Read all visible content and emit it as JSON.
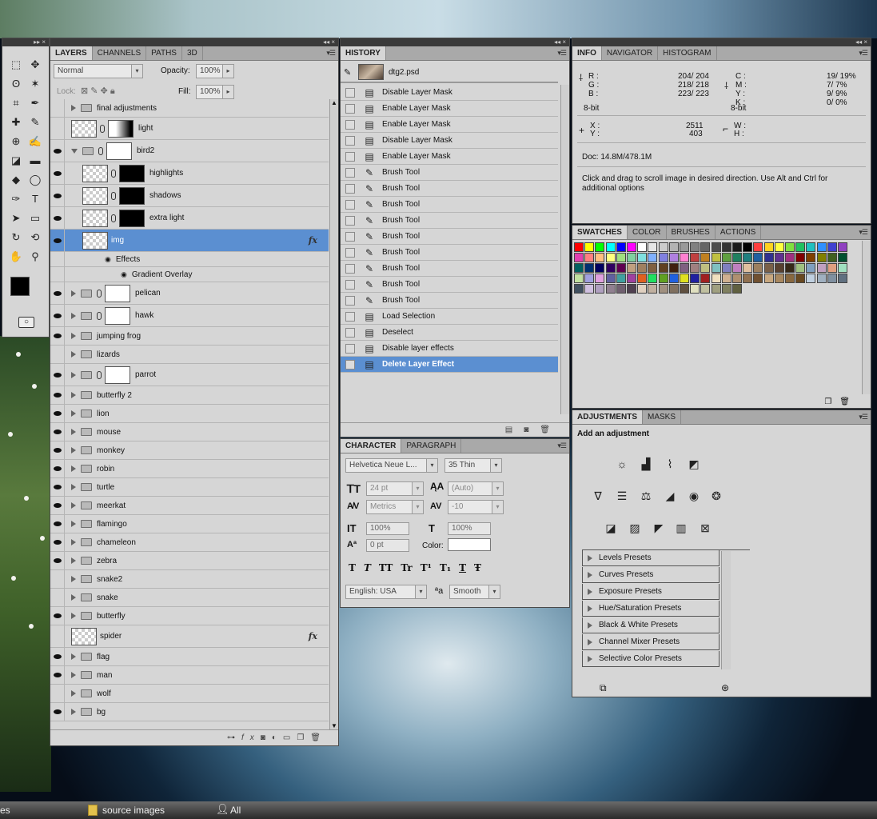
{
  "layers_panel": {
    "tabs": [
      "LAYERS",
      "CHANNELS",
      "PATHS",
      "3D"
    ],
    "blend_mode": "Normal",
    "opacity_label": "Opacity:",
    "opacity": "100%",
    "lock_label": "Lock:",
    "fill_label": "Fill:",
    "fill": "100%",
    "layers": [
      {
        "name": "final adjustments",
        "eye": false,
        "kind": "group"
      },
      {
        "name": "light",
        "eye": false,
        "kind": "layer_mask",
        "mask": "grad"
      },
      {
        "name": "bird2",
        "eye": true,
        "kind": "group_mask",
        "open": true
      },
      {
        "name": "highlights",
        "eye": true,
        "kind": "layer_mask",
        "mask": "blk",
        "indent": true
      },
      {
        "name": "shadows",
        "eye": true,
        "kind": "layer_mask",
        "mask": "blk",
        "indent": true
      },
      {
        "name": "extra light",
        "eye": true,
        "kind": "layer_mask",
        "mask": "blk",
        "indent": true
      },
      {
        "name": "img",
        "eye": true,
        "kind": "layer",
        "selected": true,
        "fx": true,
        "indent": true
      },
      {
        "name": "Effects",
        "eye": false,
        "kind": "effects"
      },
      {
        "name": "Gradient Overlay",
        "eye": false,
        "kind": "effect"
      },
      {
        "name": "pelican",
        "eye": true,
        "kind": "group_mask"
      },
      {
        "name": "hawk",
        "eye": true,
        "kind": "group_mask"
      },
      {
        "name": "jumping frog",
        "eye": true,
        "kind": "group"
      },
      {
        "name": "lizards",
        "eye": false,
        "kind": "group"
      },
      {
        "name": "parrot",
        "eye": true,
        "kind": "group_mask"
      },
      {
        "name": "butterfly 2",
        "eye": true,
        "kind": "group"
      },
      {
        "name": "lion",
        "eye": true,
        "kind": "group"
      },
      {
        "name": "mouse",
        "eye": true,
        "kind": "group"
      },
      {
        "name": "monkey",
        "eye": true,
        "kind": "group"
      },
      {
        "name": "robin",
        "eye": true,
        "kind": "group"
      },
      {
        "name": "turtle",
        "eye": true,
        "kind": "group"
      },
      {
        "name": "meerkat",
        "eye": true,
        "kind": "group"
      },
      {
        "name": "flamingo",
        "eye": true,
        "kind": "group"
      },
      {
        "name": "chameleon",
        "eye": true,
        "kind": "group"
      },
      {
        "name": "zebra",
        "eye": true,
        "kind": "group"
      },
      {
        "name": "snake2",
        "eye": false,
        "kind": "group"
      },
      {
        "name": "snake",
        "eye": false,
        "kind": "group"
      },
      {
        "name": "butterfly",
        "eye": true,
        "kind": "group"
      },
      {
        "name": "spider",
        "eye": false,
        "kind": "layer",
        "fx": true
      },
      {
        "name": "flag",
        "eye": true,
        "kind": "group"
      },
      {
        "name": "man",
        "eye": true,
        "kind": "group"
      },
      {
        "name": "wolf",
        "eye": false,
        "kind": "group"
      },
      {
        "name": "bg",
        "eye": true,
        "kind": "group"
      }
    ]
  },
  "history_panel": {
    "tab": "HISTORY",
    "doc": "dtg2.psd",
    "states": [
      {
        "label": "Disable Layer Mask",
        "icon": "doc"
      },
      {
        "label": "Enable Layer Mask",
        "icon": "doc"
      },
      {
        "label": "Enable Layer Mask",
        "icon": "doc"
      },
      {
        "label": "Disable Layer Mask",
        "icon": "doc"
      },
      {
        "label": "Enable Layer Mask",
        "icon": "doc"
      },
      {
        "label": "Brush Tool",
        "icon": "brush"
      },
      {
        "label": "Brush Tool",
        "icon": "brush"
      },
      {
        "label": "Brush Tool",
        "icon": "brush"
      },
      {
        "label": "Brush Tool",
        "icon": "brush"
      },
      {
        "label": "Brush Tool",
        "icon": "brush"
      },
      {
        "label": "Brush Tool",
        "icon": "brush"
      },
      {
        "label": "Brush Tool",
        "icon": "brush"
      },
      {
        "label": "Brush Tool",
        "icon": "brush"
      },
      {
        "label": "Brush Tool",
        "icon": "brush"
      },
      {
        "label": "Load Selection",
        "icon": "doc"
      },
      {
        "label": "Deselect",
        "icon": "doc"
      },
      {
        "label": "Disable layer effects",
        "icon": "doc"
      },
      {
        "label": "Delete Layer Effect",
        "icon": "doc",
        "selected": true
      }
    ]
  },
  "character_panel": {
    "tabs": [
      "CHARACTER",
      "PARAGRAPH"
    ],
    "font": "Helvetica Neue L...",
    "style": "35 Thin",
    "size": "24 pt",
    "leading": "(Auto)",
    "kerning": "Metrics",
    "tracking": "-10",
    "vscale": "100%",
    "hscale": "100%",
    "baseline": "0 pt",
    "color_label": "Color:",
    "styles": [
      "T",
      "T",
      "TT",
      "Tr",
      "T¹",
      "T₁",
      "T",
      "Ŧ"
    ],
    "language": "English: USA",
    "aa_icon": "ªa",
    "antialias": "Smooth"
  },
  "info_panel": {
    "tabs": [
      "INFO",
      "NAVIGATOR",
      "HISTOGRAM"
    ],
    "rgb": [
      {
        "k": "R :",
        "v": "204/ 204"
      },
      {
        "k": "G :",
        "v": "218/ 218"
      },
      {
        "k": "B :",
        "v": "223/ 223"
      }
    ],
    "cmyk": [
      {
        "k": "C :",
        "v": "19/ 19%"
      },
      {
        "k": "M :",
        "v": "7/ 7%"
      },
      {
        "k": "Y :",
        "v": "9/ 9%"
      },
      {
        "k": "K :",
        "v": "0/ 0%"
      }
    ],
    "bits": "8-bit",
    "x_label": "X :",
    "y_label": "Y :",
    "x": "2511",
    "y": "403",
    "w_label": "W :",
    "h_label": "H :",
    "doc": "Doc: 14.8M/478.1M",
    "hint": "Click and drag to scroll image in desired direction.  Use Alt and Ctrl for additional options"
  },
  "swatches_panel": {
    "tabs": [
      "SWATCHES",
      "COLOR",
      "BRUSHES",
      "ACTIONS"
    ],
    "colors": [
      "#ff0000",
      "#ffff00",
      "#00ff00",
      "#00ffff",
      "#0000ff",
      "#ff00ff",
      "#ffffff",
      "#e6e6e6",
      "#cccccc",
      "#b3b3b3",
      "#999999",
      "#808080",
      "#666666",
      "#4d4d4d",
      "#333333",
      "#1a1a1a",
      "#000000",
      "#ff4040",
      "#ffd21f",
      "#ffff40",
      "#80e040",
      "#20c060",
      "#20c0c0",
      "#3090ff",
      "#4040d0",
      "#9040c0",
      "#e040b0",
      "#ff8080",
      "#ffc080",
      "#ffff80",
      "#a0e080",
      "#80d0a0",
      "#80e0e0",
      "#80b0ff",
      "#8080e0",
      "#b080e0",
      "#ff80d0",
      "#c04040",
      "#c08020",
      "#c0c040",
      "#60a040",
      "#208060",
      "#208080",
      "#2060a0",
      "#303090",
      "#603090",
      "#a03080",
      "#800000",
      "#804000",
      "#808000",
      "#406020",
      "#005030",
      "#006060",
      "#003070",
      "#000060",
      "#300060",
      "#600050",
      "#c0a080",
      "#a08060",
      "#806040",
      "#604020",
      "#402010",
      "#806080",
      "#a08080",
      "#c0c080",
      "#80c0c0",
      "#8080c0",
      "#c080c0",
      "#e0c0a0",
      "#9c8060",
      "#7a6048",
      "#584030",
      "#362818",
      "#a0c080",
      "#80a0c0",
      "#c0a0c0",
      "#e0a080",
      "#a0e0c0",
      "#c0e0a0",
      "#a0a0e0",
      "#e0a0e0",
      "#6060a0",
      "#40a0a0",
      "#a040a0",
      "#e06020",
      "#20e060",
      "#60a020",
      "#2060e0",
      "#e0e020",
      "#2020a0",
      "#a02020",
      "#f0e0c0",
      "#d0b090",
      "#b09070",
      "#907050",
      "#705030",
      "#c8a880",
      "#a88860",
      "#886840",
      "#684820",
      "#c0d0e0",
      "#a0b0c0",
      "#8090a0",
      "#607080",
      "#405060",
      "#d0c0e0",
      "#b0a0c0",
      "#908090",
      "#706070",
      "#504050",
      "#e0d0c0",
      "#c0b0a0",
      "#a09080",
      "#807060",
      "#605040",
      "#e0e0c0",
      "#c0c0a0",
      "#a0a080",
      "#808060",
      "#606040"
    ]
  },
  "adjustments_panel": {
    "tabs": [
      "ADJUSTMENTS",
      "MASKS"
    ],
    "title": "Add an adjustment",
    "presets": [
      "Levels Presets",
      "Curves Presets",
      "Exposure Presets",
      "Hue/Saturation Presets",
      "Black & White Presets",
      "Channel Mixer Presets",
      "Selective Color Presets"
    ]
  },
  "taskbar": {
    "items": [
      "es",
      "source images",
      "All"
    ]
  }
}
